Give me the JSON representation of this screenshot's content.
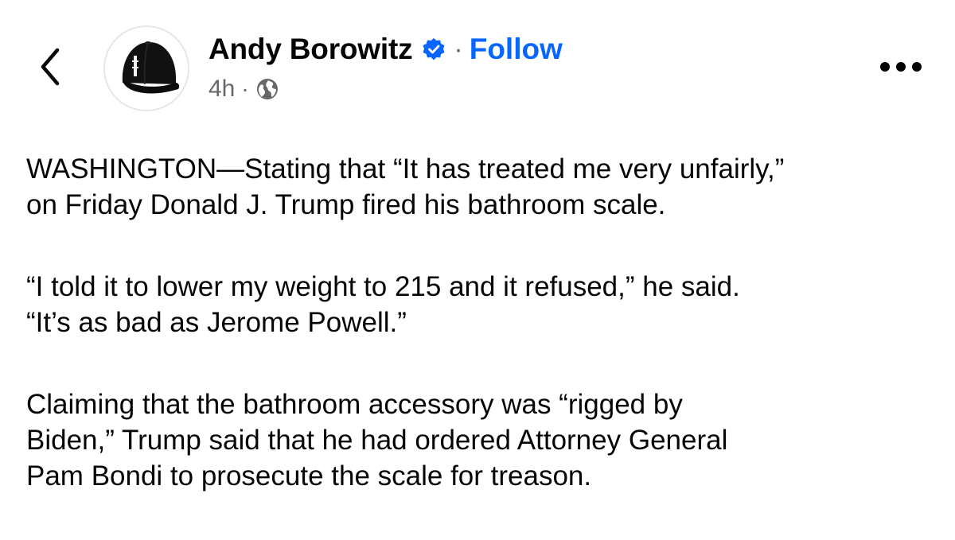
{
  "post": {
    "author": {
      "name": "Andy Borowitz",
      "verified": true,
      "verified_icon": "verified-badge-icon",
      "avatar_icon": "black-cap-avatar"
    },
    "follow_label": "Follow",
    "separator": "·",
    "timestamp": "4h",
    "audience_icon": "globe-icon",
    "back_icon": "chevron-left-icon",
    "more_icon": "more-horizontal-icon",
    "paragraphs": [
      {
        "lines": [
          "WASHINGTON—Stating that “It has treated me very unfairly,”",
          "on Friday Donald J. Trump fired his bathroom scale."
        ]
      },
      {
        "lines": [
          "“I told it to lower my weight to 215 and it refused,” he said.",
          "“It’s as bad as Jerome Powell.”"
        ]
      },
      {
        "lines": [
          "Claiming that the bathroom accessory was “rigged by",
          "Biden,” Trump said that he had ordered Attorney General",
          "Pam Bondi to prosecute the scale for treason."
        ]
      }
    ]
  },
  "colors": {
    "link_blue": "#0866ff",
    "text_primary": "#050505",
    "text_secondary": "#65676b",
    "background": "#ffffff"
  }
}
